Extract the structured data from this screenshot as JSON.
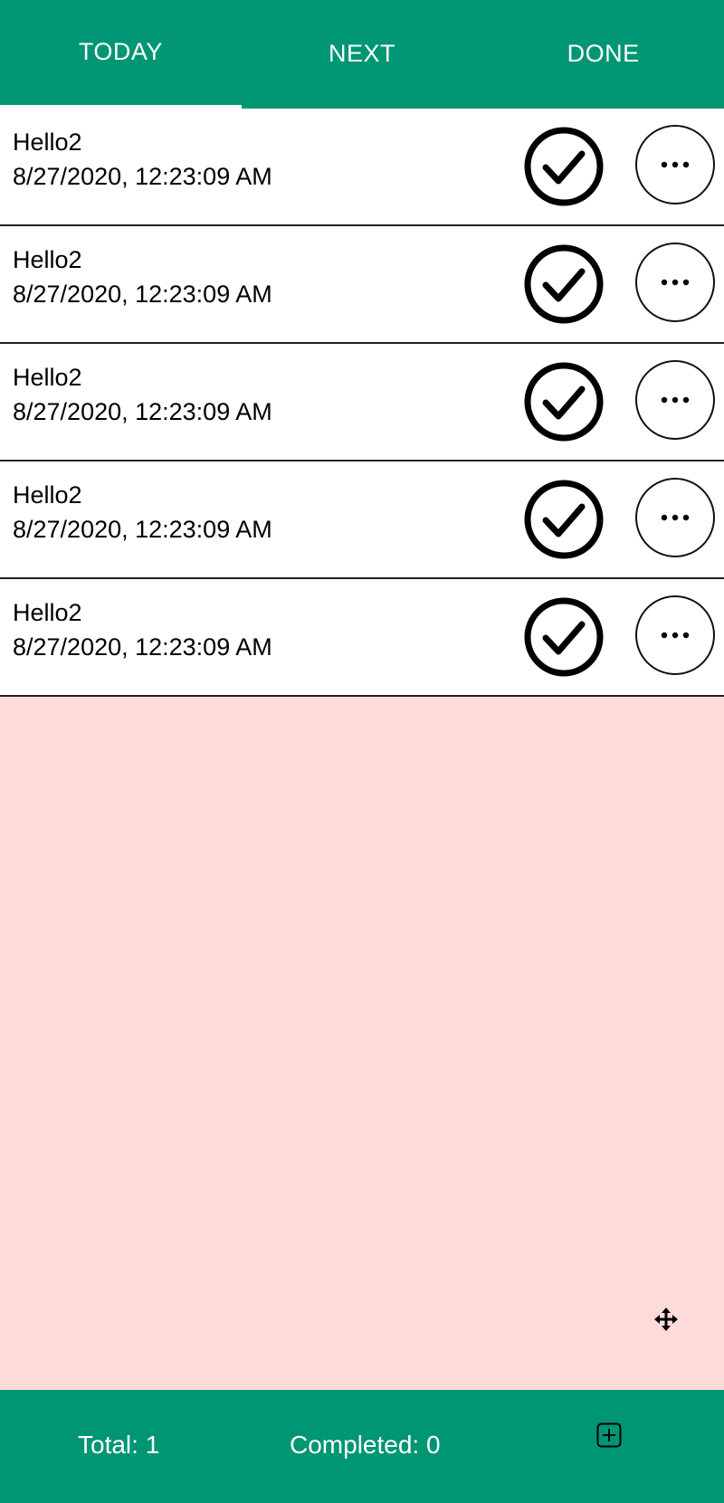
{
  "tabs": [
    {
      "label": "TODAY",
      "active": true
    },
    {
      "label": "NEXT",
      "active": false
    },
    {
      "label": "DONE",
      "active": false
    }
  ],
  "tasks": [
    {
      "title": "Hello2",
      "datetime": "8/27/2020, 12:23:09 AM"
    },
    {
      "title": "Hello2",
      "datetime": "8/27/2020, 12:23:09 AM"
    },
    {
      "title": "Hello2",
      "datetime": "8/27/2020, 12:23:09 AM"
    },
    {
      "title": "Hello2",
      "datetime": "8/27/2020, 12:23:09 AM"
    },
    {
      "title": "Hello2",
      "datetime": "8/27/2020, 12:23:09 AM"
    }
  ],
  "icons": {
    "row_check": "check-circle-icon",
    "row_more": "more-horizontal-icon",
    "move": "move-icon",
    "add": "plus-square-icon"
  },
  "footer": {
    "total_text": "Total: 1",
    "completed_text": "Completed: 0"
  },
  "colors": {
    "header_bg": "#009673",
    "footer_bg": "#009673",
    "page_bg": "#fddbd9",
    "row_bg": "#ffffff",
    "tab_text": "#ffffff"
  }
}
